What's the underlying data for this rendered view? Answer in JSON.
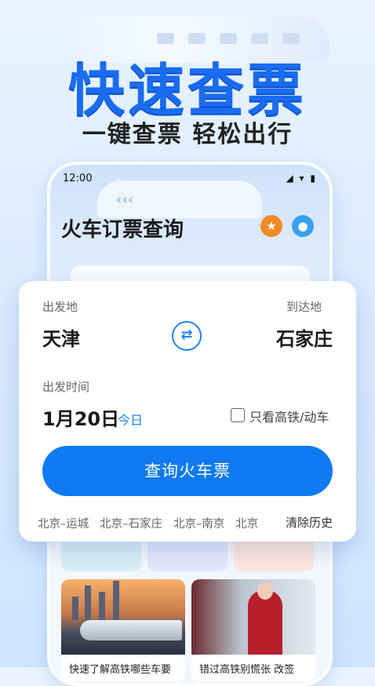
{
  "hero": {
    "title": "快速查票",
    "subtitle": "一键查票 轻松出行"
  },
  "phone": {
    "status_time": "12:00",
    "status_icons": "◢ ▾ ▮",
    "title": "火车订票查询",
    "header_icons": [
      "star-icon",
      "user-icon"
    ],
    "train_arrows": "‹‹‹",
    "news": [
      {
        "caption": "快速了解高铁哪些车要"
      },
      {
        "caption": "错过高铁别慌张 改签"
      }
    ]
  },
  "search": {
    "from_label": "出发地",
    "to_label": "到达地",
    "from_city": "天津",
    "to_city": "石家庄",
    "swap_icon": "⇄",
    "time_label": "出发时间",
    "date": "1月20日",
    "today": "今日",
    "high_speed_label": "只看高铁/动车",
    "high_speed_checked": false,
    "query_button": "查询火车票",
    "history": [
      "北京–运城",
      "北京–石家庄",
      "北京–南京",
      "北京"
    ],
    "clear_history": "清除历史"
  },
  "colors": {
    "accent": "#0f7af2",
    "title_blue": "#1a6cf0",
    "star_orange": "#f08a24",
    "user_blue": "#3aa0f0"
  }
}
